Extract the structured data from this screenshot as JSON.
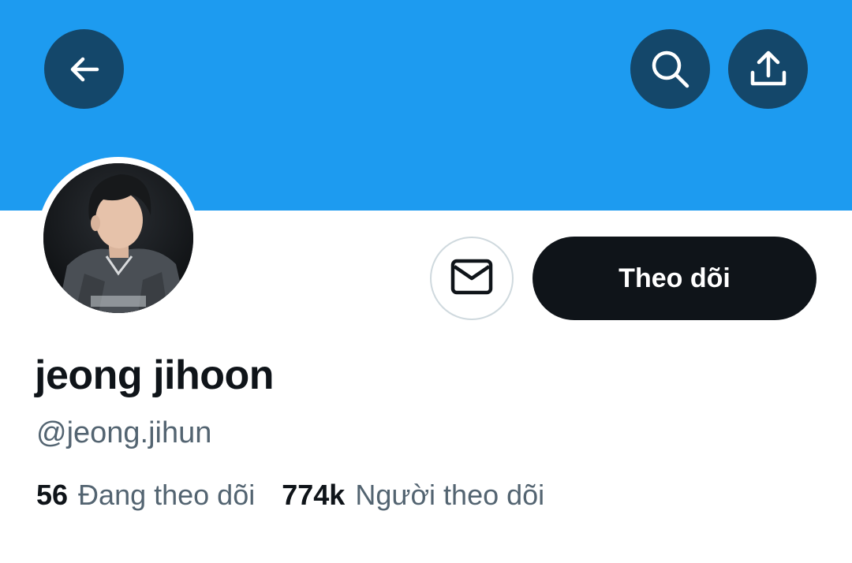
{
  "header": {
    "banner_color": "#1d9bf0",
    "back_icon": "arrow-left-icon",
    "search_icon": "search-icon",
    "share_icon": "share-upload-icon"
  },
  "profile": {
    "avatar": "profile-photo",
    "display_name": "jeong jihoon",
    "handle": "@jeong.jihun",
    "message_icon": "envelope-icon",
    "follow_label": "Theo dõi"
  },
  "stats": {
    "following_count": "56",
    "following_label": "Đang theo dõi",
    "followers_count": "774k",
    "followers_label": "Người theo dõi"
  }
}
